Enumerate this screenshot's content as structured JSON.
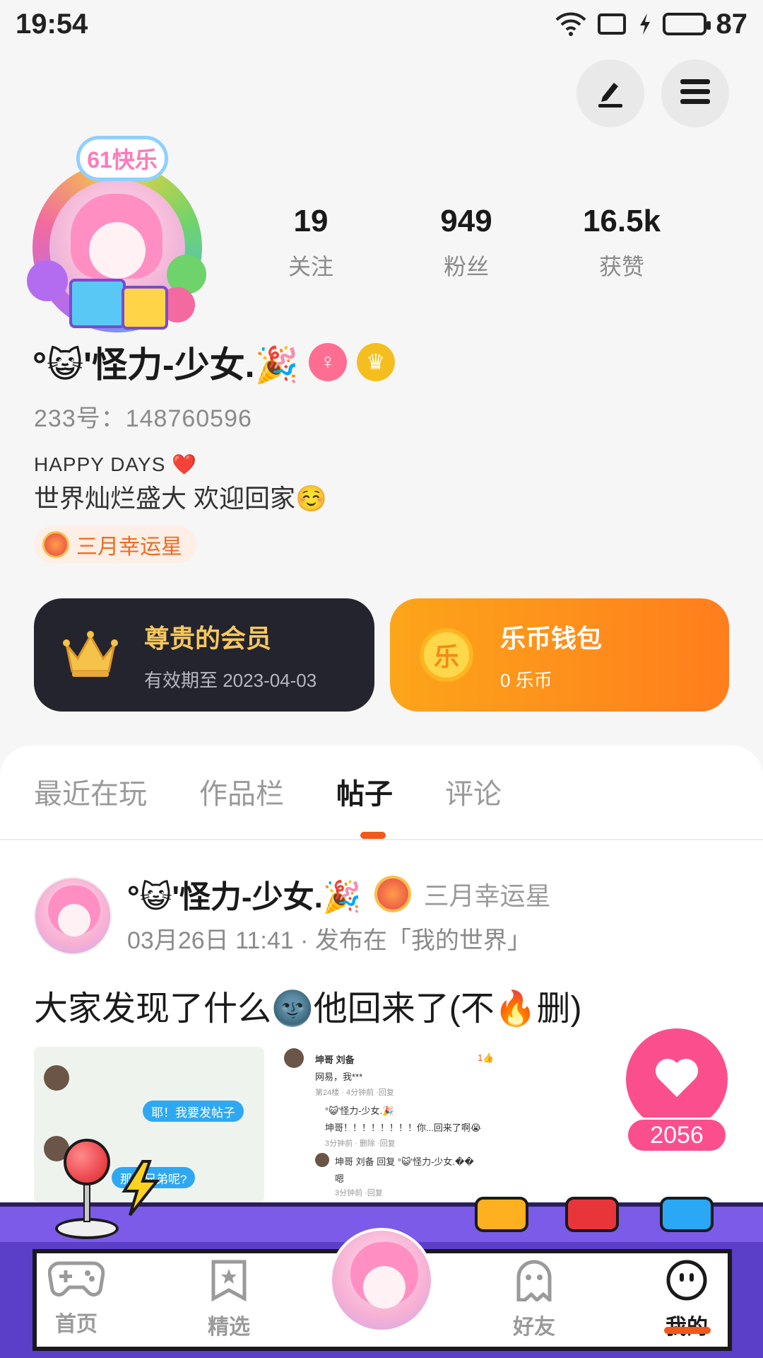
{
  "status_bar": {
    "time": "19:54",
    "battery": "87"
  },
  "profile": {
    "avatar_badge": "61快乐",
    "name": "°😺'怪力-少女.🎉",
    "uid": "233号：148760596",
    "bio_line1": "HAPPY DAYS ❤️ ",
    "bio_line2": "世界灿烂盛大 欢迎回家☺️",
    "tag": "三月幸运星",
    "stats": [
      {
        "num": "19",
        "label": "关注"
      },
      {
        "num": "949",
        "label": "粉丝"
      },
      {
        "num": "16.5k",
        "label": "获赞"
      }
    ]
  },
  "cards": {
    "vip": {
      "title": "尊贵的会员",
      "sub": "有效期至 2023-04-03"
    },
    "wallet": {
      "icon_text": "乐",
      "title": "乐币钱包",
      "sub": "0 乐币"
    }
  },
  "tabs": [
    {
      "label": "最近在玩",
      "active": false
    },
    {
      "label": "作品栏",
      "active": false
    },
    {
      "label": "帖子",
      "active": true
    },
    {
      "label": "评论",
      "active": false
    }
  ],
  "post": {
    "author": "°😺'怪力-少女.🎉",
    "tag": "三月幸运星",
    "meta": "03月26日 11:41 · 发布在「我的世界」",
    "text": "大家发现了什么🌚他回来了(不🔥删)",
    "likes": "2056",
    "shot1": {
      "bubble1": "耶！我要发帖子",
      "bubble2": "那俩兄弟呢?"
    },
    "shot2": {
      "l1": "坤哥  刘备",
      "l1_like": "1👍",
      "l2": "网易，我***",
      "l3": "第24楼 · 4分钟前 ·回复",
      "l4": "°😺'怪力-少女.🎉",
      "l5": "坤哥！！！！！！！！你...回来了啊😭",
      "l6": "3分钟前 · 删除 ·回复",
      "l7": "坤哥  刘备 回复 °😺'怪力-少女.��",
      "l8": "嗯",
      "l9": "3分钟前 ·回复"
    }
  },
  "bottom_nav": [
    {
      "label": "首页",
      "icon": "gamepad-icon",
      "active": false
    },
    {
      "label": "精选",
      "icon": "star-bookmark-icon",
      "active": false
    },
    {
      "label": "好友",
      "icon": "ghost-icon",
      "active": false
    },
    {
      "label": "我的",
      "icon": "smile-face-icon",
      "active": true
    }
  ],
  "colors": {
    "accent": "#f2581a",
    "like_pink": "#fb4f8d",
    "vip_dark": "#24242e",
    "wallet_orange": "#fca51a",
    "arcade_purple": "#5b3fc9"
  }
}
